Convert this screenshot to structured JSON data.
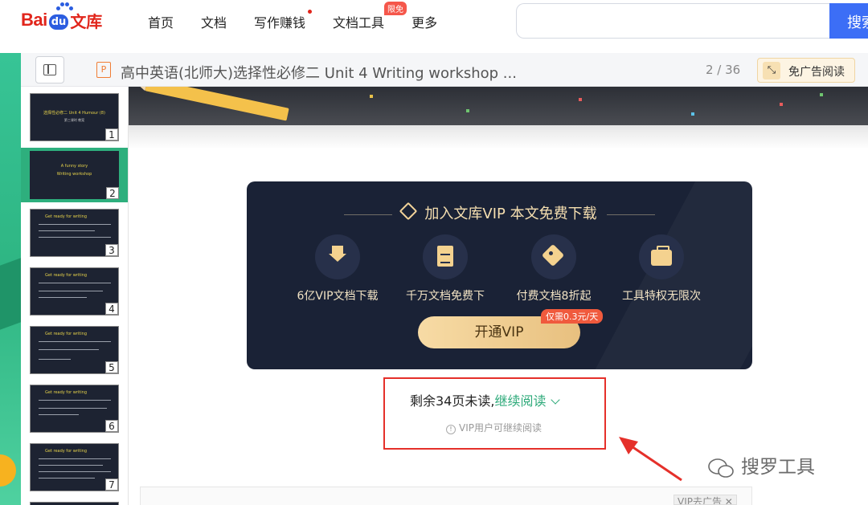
{
  "header": {
    "logo_bai": "Bai",
    "logo_du": "du",
    "logo_wenku": "文库",
    "nav": [
      {
        "label": "首页"
      },
      {
        "label": "文档"
      },
      {
        "label": "写作赚钱"
      },
      {
        "label": "文档工具",
        "badge": "限免"
      },
      {
        "label": "更多"
      }
    ],
    "search_placeholder": "",
    "search_button": "搜索"
  },
  "docbar": {
    "type_tag": "P",
    "title": "高中英语(北师大)选择性必修二 Unit 4 Writing workshop ...",
    "page_indicator": "2 / 36",
    "noad_button": "免广告阅读",
    "noad_icon": "expand-icon"
  },
  "thumbnails": [
    {
      "num": "1",
      "title": "选择性必修二 Unit 4 Humour (8)",
      "subtitle": "第三课时 教案"
    },
    {
      "num": "2",
      "title": "A funny story",
      "subtitle": "Writing workshop",
      "active": true
    },
    {
      "num": "3",
      "title": "Get ready for writing"
    },
    {
      "num": "4",
      "title": "Get ready for writing"
    },
    {
      "num": "5",
      "title": "Get ready for writing"
    },
    {
      "num": "6",
      "title": "Get ready for writing"
    },
    {
      "num": "7",
      "title": "Get ready for writing"
    }
  ],
  "vip": {
    "title": "加入文库VIP 本文免费下载",
    "features": [
      {
        "icon": "download-icon",
        "label": "6亿VIP文档下载"
      },
      {
        "icon": "document-icon",
        "label": "千万文档免费下"
      },
      {
        "icon": "tag-icon",
        "label": "付费文档8折起"
      },
      {
        "icon": "toolbox-icon",
        "label": "工具特权无限次"
      }
    ],
    "button": "开通VIP",
    "price_tag": "仅需0.3元/天"
  },
  "continue": {
    "remaining": "剩余34页未读,",
    "link": "继续阅读",
    "note": "VIP用户可继续阅读"
  },
  "footer": {
    "vip_noad": "VIP去广告 ✕"
  },
  "watermark": {
    "text": "搜罗工具"
  },
  "colors": {
    "accent_blue": "#3c6ef6",
    "brand_red": "#e1251b",
    "green": "#2eaa7a",
    "vip_card": "#1a2236",
    "highlight_box": "#e5302a"
  }
}
